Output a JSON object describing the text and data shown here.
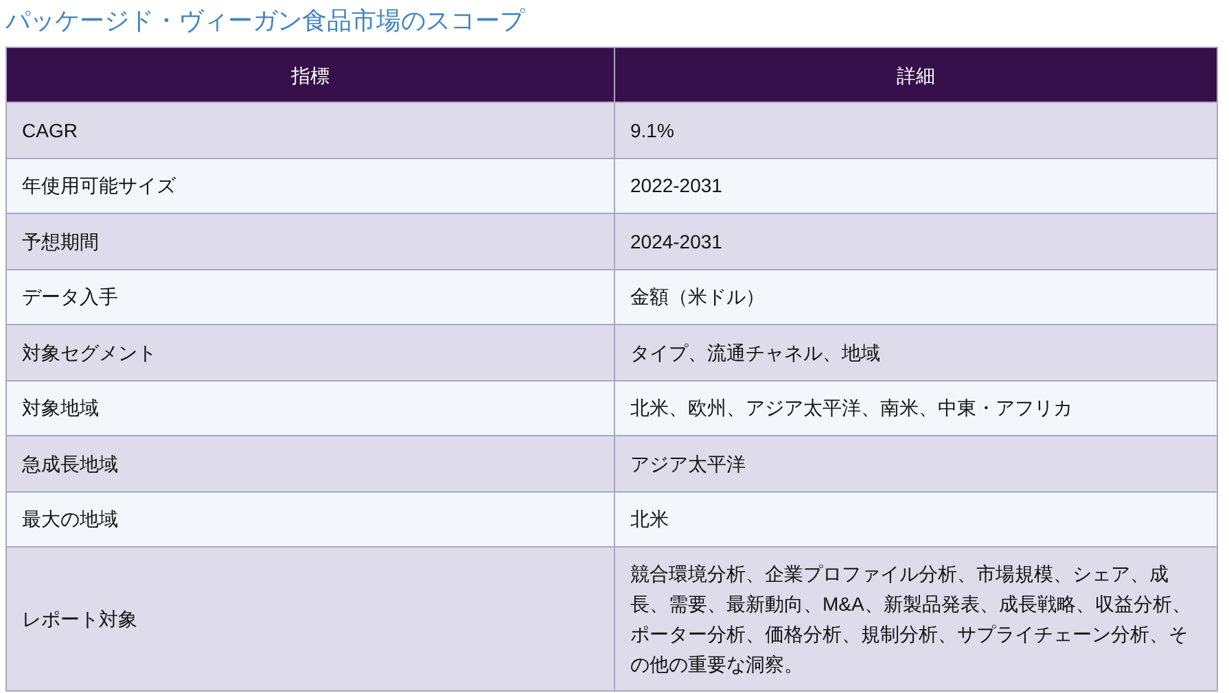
{
  "title": "パッケージド・ヴィーガン食品市場のスコープ",
  "table": {
    "columns": [
      "指標",
      "詳細"
    ],
    "rows": [
      [
        "CAGR",
        "9.1%"
      ],
      [
        "年使用可能サイズ",
        "2022-2031"
      ],
      [
        "予想期間",
        "2024-2031"
      ],
      [
        "データ入手",
        "金額（米ドル）"
      ],
      [
        "対象セグメント",
        "タイプ、流通チャネル、地域"
      ],
      [
        "対象地域",
        "北米、欧州、アジア太平洋、南米、中東・アフリカ"
      ],
      [
        "急成長地域",
        "アジア太平洋"
      ],
      [
        "最大の地域",
        "北米"
      ],
      [
        "レポート対象",
        "競合環境分析、企業プロファイル分析、市場規模、シェア、成長、需要、最新動向、M&A、新製品発表、成長戦略、収益分析、ポーター分析、価格分析、規制分析、サプライチェーン分析、その他の重要な洞察。"
      ]
    ]
  }
}
